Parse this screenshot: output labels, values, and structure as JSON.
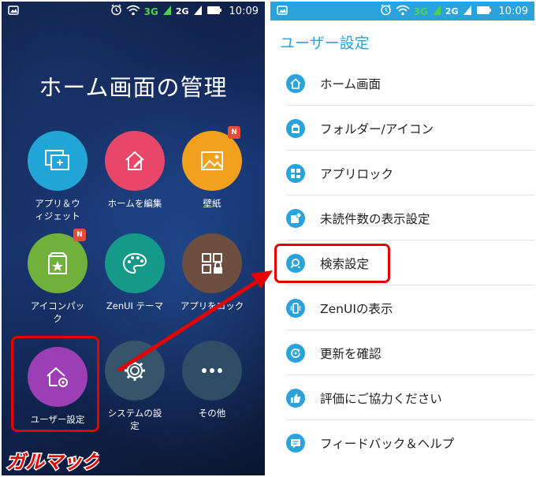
{
  "left_screen": {
    "status": {
      "time": "10:09",
      "signal_1": "3G",
      "signal_2": "2G"
    },
    "title": "ホーム画面の管理",
    "tiles": [
      {
        "label": "アプリ＆ウィジェット",
        "label_l1": "アプリ＆ウ",
        "label_l2": "ィジェット",
        "color": "#22a6d8",
        "icon": "apps-widgets-icon"
      },
      {
        "label": "ホームを編集",
        "color": "#e8476a",
        "icon": "edit-home-icon"
      },
      {
        "label": "壁紙",
        "color": "#f2a11f",
        "icon": "wallpaper-icon",
        "badge": "N"
      },
      {
        "label": "アイコンパック",
        "label_l1": "アイコンパッ",
        "label_l2": "ク",
        "color": "#6fb13a",
        "icon": "icon-pack-icon",
        "badge": "N"
      },
      {
        "label": "ZenUI テーマ",
        "color": "#159a8a",
        "icon": "palette-icon"
      },
      {
        "label": "アプリをロック",
        "color": "#6d4e3f",
        "icon": "app-lock-icon"
      },
      {
        "label": "ユーザー設定",
        "color": "#9c3fb5",
        "icon": "user-settings-icon"
      },
      {
        "label": "システムの設定",
        "label_l1": "システムの設",
        "label_l2": "定",
        "color": "#36546a",
        "icon": "gear-icon"
      },
      {
        "label": "その他",
        "color": "#2f4d66",
        "icon": "more-icon"
      }
    ],
    "watermark": "ガルマックス"
  },
  "right_screen": {
    "status": {
      "time": "10:09",
      "signal_1": "3G",
      "signal_2": "2G"
    },
    "header_title": "ユーザー設定",
    "menu": [
      {
        "label": "ホーム画面",
        "icon": "home-icon"
      },
      {
        "label": "フォルダー/アイコン",
        "icon": "folder-icon"
      },
      {
        "label": "アプリロック",
        "icon": "app-lock-icon"
      },
      {
        "label": "未読件数の表示設定",
        "icon": "unread-badge-icon"
      },
      {
        "label": "検索設定",
        "icon": "search-settings-icon"
      },
      {
        "label": "ZenUIの表示",
        "icon": "zenui-display-icon"
      },
      {
        "label": "更新を確認",
        "icon": "update-check-icon"
      },
      {
        "label": "評価にご協力ください",
        "icon": "thumbs-up-icon"
      },
      {
        "label": "フィードバック＆ヘルプ",
        "icon": "feedback-icon"
      }
    ]
  },
  "colors": {
    "accent": "#2aa3dc",
    "highlight": "#e60000"
  }
}
